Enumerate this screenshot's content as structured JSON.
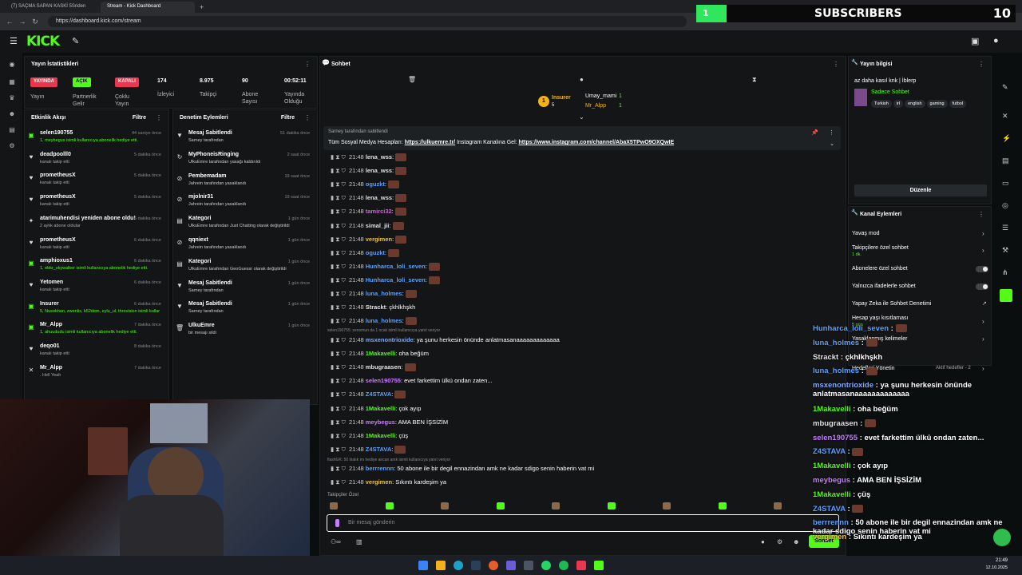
{
  "browser": {
    "tabs": [
      {
        "label": "(7) SAÇMA SAPAN KASKİ 5Sriden"
      },
      {
        "label": "Stream - Kick Dashboard"
      }
    ],
    "url": "https://dashboard.kick.com/stream"
  },
  "subs_overlay": {
    "start": "1",
    "label": "SUBSCRIBERS",
    "count": "10",
    "progress": 0.1
  },
  "header": {
    "logo": "KICK"
  },
  "stats": {
    "title": "Yayın İstatistikleri",
    "badges": [
      {
        "text": "YAYINDA",
        "label": "Yayın",
        "color": "#e8374f"
      },
      {
        "text": "AÇIK",
        "label": "Partnerlik Gelir",
        "color": "#53fc18"
      },
      {
        "text": "KAPALI",
        "label": "Çoklu Yayın",
        "color": "#e8374f"
      }
    ],
    "values": [
      {
        "value": "174",
        "label": "İzleyici"
      },
      {
        "value": "8.975",
        "label": "Takipçi"
      },
      {
        "value": "90",
        "label": "Abone Sayısı"
      },
      {
        "value": "00:52:11",
        "label": "Yayında Olduğu"
      }
    ]
  },
  "activity": {
    "title": "Etkinlik Akışı",
    "filter": "Filtre",
    "items": [
      {
        "name": "selen190755",
        "sub": "1, meybegus isimli kullanıcıya abonelik hediye etti.",
        "time": "44 saniye önce",
        "icon": "gift-icon"
      },
      {
        "name": "deadpoolll0",
        "sub": "kanalı takip etti",
        "time": "5 dakika önce",
        "icon": "heart-icon"
      },
      {
        "name": "prometheusX",
        "sub": "kanalı takip etti",
        "time": "5 dakika önce",
        "icon": "heart-icon"
      },
      {
        "name": "prometheusX",
        "sub": "kanalı takip etti",
        "time": "5 dakika önce",
        "icon": "heart-icon"
      },
      {
        "name": "atarimuhendisi yeniden abone oldu!",
        "sub": "2 aylık abone oldular",
        "time": "6 dakika önce",
        "icon": "star-icon"
      },
      {
        "name": "prometheusX",
        "sub": "kanalı takip etti",
        "time": "6 dakika önce",
        "icon": "heart-icon"
      },
      {
        "name": "amphioxus1",
        "sub": "1, ebkr_skywalker isimli kullanıcıya abonelik hediye etti.",
        "time": "6 dakika önce",
        "icon": "gift-icon"
      },
      {
        "name": "Yetomen",
        "sub": "kanalı takip etti",
        "time": "6 dakika önce",
        "icon": "heart-icon"
      },
      {
        "name": "Insurer",
        "sub": "5, Nusokhan, zwenlis, k52dem, eylu_ul, throvision isimli kullanıcıya abonelik hediye etti.",
        "time": "6 dakika önce",
        "icon": "gift-icon"
      },
      {
        "name": "Mr_Alpp",
        "sub": "1, ahuududu isimli kullanıcıya abonelik hediye etti.",
        "time": "7 dakika önce",
        "icon": "gift-icon"
      },
      {
        "name": "deqo01",
        "sub": "kanalı takip etti",
        "time": "8 dakika önce",
        "icon": "heart-icon"
      },
      {
        "name": "Mr_Alpp",
        "sub": ". Hell Yeah",
        "time": "7 dakika önce",
        "icon": "x-icon"
      }
    ]
  },
  "moderation": {
    "title": "Denetim Eylemleri",
    "filter": "Filtre",
    "items": [
      {
        "name": "Mesaj Sabitlendi",
        "sub": "Sarney tarafından",
        "time": "51 dakika önce",
        "icon": "pin-icon"
      },
      {
        "name": "MyPhoneisRinging",
        "sub": "UlkuEmre tarafından yasağı kaldırıldı",
        "time": "2 saat önce",
        "icon": "unban-icon"
      },
      {
        "name": "Pembemadam",
        "sub": "Jahrein tarafından yasaklandı",
        "time": "19 saat önce",
        "icon": "ban-icon"
      },
      {
        "name": "mjolnir31",
        "sub": "Jahrein tarafından yasaklandı",
        "time": "19 saat önce",
        "icon": "ban-icon"
      },
      {
        "name": "Kategori",
        "sub": "UlkuEmre tarafından Just Chatting olarak değiştirildi",
        "time": "1 gün önce",
        "icon": "category-icon"
      },
      {
        "name": "qqniext",
        "sub": "Jahrein tarafından yasaklandı",
        "time": "1 gün önce",
        "icon": "ban-icon"
      },
      {
        "name": "Kategori",
        "sub": "UlkuEmre tarafından GeoGuessr olarak değiştirildi",
        "time": "1 gün önce",
        "icon": "category-icon"
      },
      {
        "name": "Mesaj Sabitlendi",
        "sub": "Sarney tarafından",
        "time": "1 gün önce",
        "icon": "pin-icon"
      },
      {
        "name": "Mesaj Sabitlendi",
        "sub": "Sarney tarafından",
        "time": "1 gün önce",
        "icon": "pin-icon"
      },
      {
        "name": "UlkuEmre",
        "sub": "bir mesajı sildi",
        "time": "1 gün önce",
        "icon": "trash-icon"
      }
    ]
  },
  "chat": {
    "title": "Sohbet",
    "top_gifters": [
      {
        "name": "Insurer",
        "count": "5"
      },
      {
        "name": "Umay_mami",
        "count": "1"
      },
      {
        "name": "Mr_Alpp",
        "count": "1"
      }
    ],
    "pinned": {
      "by": "Sarney tarafından sabitlendi",
      "text_prefix": "Tüm Sosyal Medya Hesapları:",
      "link1": "https://ulkuemre.tr/",
      "middle": "Instagram Kanalına Gel:",
      "link2": "https://www.instagram.com/channel/AbaX5TPwO9OXQwIE"
    },
    "messages": [
      {
        "time": "21:48",
        "user": "lena_wss",
        "color": "#e0e0e0",
        "text": ""
      },
      {
        "time": "21:48",
        "user": "lena_wss",
        "color": "#e0e0e0",
        "text": ""
      },
      {
        "time": "21:48",
        "user": "oguzkt",
        "color": "#5aa0ff",
        "text": ""
      },
      {
        "time": "21:48",
        "user": "lena_wss",
        "color": "#e0e0e0",
        "text": ""
      },
      {
        "time": "21:48",
        "user": "tamirci32",
        "color": "#d45fd9",
        "text": ""
      },
      {
        "time": "21:48",
        "user": "simal_jii",
        "color": "#e0e0e0",
        "text": ""
      },
      {
        "time": "21:48",
        "user": "vergimen",
        "color": "#e8c24a",
        "text": ""
      },
      {
        "time": "21:48",
        "user": "oguzkt",
        "color": "#5aa0ff",
        "text": ""
      },
      {
        "time": "21:48",
        "user": "Hunharca_loli_seven",
        "color": "#5aa0ff",
        "text": ""
      },
      {
        "time": "21:48",
        "user": "Hunharca_loli_seven",
        "color": "#5aa0ff",
        "text": ""
      },
      {
        "time": "21:48",
        "user": "luna_holmes",
        "color": "#5aa0ff",
        "text": ""
      },
      {
        "time": "21:48",
        "user": "Strackt",
        "color": "#e0e0e0",
        "text": "çkhlkhşkh"
      },
      {
        "time": "21:48",
        "user": "luna_holmes",
        "color": "#5aa0ff",
        "text": ""
      }
    ],
    "reply_note_1": "selen190755: zenomun da 1 ocak isimli kullanıcıya yanıt veriyor",
    "messages2": [
      {
        "time": "21:48",
        "user": "msxenontrioxide",
        "color": "#7fa8ff",
        "text": "ya şunu herkesin önünde anlatmasanaaaaaaaaaaaaa"
      },
      {
        "time": "21:48",
        "user": "1Makavelli",
        "color": "#53fc18",
        "text": "oha beğüm"
      },
      {
        "time": "21:48",
        "user": "mbugraasen",
        "color": "#e0e0e0",
        "text": ""
      },
      {
        "time": "21:48",
        "user": "selen190755",
        "color": "#c77dff",
        "text": "evet farkettim ülkü ondan zaten..."
      },
      {
        "time": "21:48",
        "user": "Z4STAVA",
        "color": "#5aa0ff",
        "text": ""
      },
      {
        "time": "21:48",
        "user": "1Makavelli",
        "color": "#53fc18",
        "text": "çok ayıp"
      },
      {
        "time": "21:48",
        "user": "meybegus",
        "color": "#c77dff",
        "text": "AMA BEN İŞSİZİM"
      },
      {
        "time": "21:48",
        "user": "1Makavelli",
        "color": "#53fc18",
        "text": "çüş"
      },
      {
        "time": "21:48",
        "user": "Z4STAVA",
        "color": "#5aa0ff",
        "text": ""
      }
    ],
    "reply_note_2": "flashGK: 50 liralık mı hediye aircan amk isimli kullanıcıya yanıt veriyor",
    "messages3": [
      {
        "time": "21:48",
        "user": "berrrennn",
        "color": "#5aa0ff",
        "text": "50 abone ile bir degil ennazindan amk ne kadar sdigo senin haberin vat mi"
      },
      {
        "time": "21:48",
        "user": "vergimen",
        "color": "#e8c24a",
        "text": "Sıkıntı kardeşim ya"
      }
    ],
    "followers_only": "Takipçiler Özel",
    "input_placeholder": "Bir mesaj gönderin",
    "send_label": "Sohbet"
  },
  "overlay_chat": [
    {
      "user": "Hunharca_loli_seven",
      "color": "#5aa0ff",
      "text": ""
    },
    {
      "user": "luna_holmes",
      "color": "#5aa0ff",
      "text": ""
    },
    {
      "user": "Strackt",
      "color": "#e0e0e0",
      "text": "çkhlkhşkh"
    },
    {
      "user": "luna_holmes",
      "color": "#5aa0ff",
      "text": ""
    },
    {
      "user": "msxenontrioxide",
      "color": "#7fa8ff",
      "text": "ya şunu herkesin önünde anlatmasanaaaaaaaaaaaaa"
    },
    {
      "user": "1Makavelli",
      "color": "#53fc18",
      "text": "oha beğüm"
    },
    {
      "user": "mbugraasen",
      "color": "#e0e0e0",
      "text": ""
    },
    {
      "user": "selen190755",
      "color": "#c77dff",
      "text": "evet farkettim ülkü ondan zaten..."
    },
    {
      "user": "Z4STAVA",
      "color": "#5aa0ff",
      "text": ""
    },
    {
      "user": "1Makavelli",
      "color": "#53fc18",
      "text": "çok ayıp"
    },
    {
      "user": "meybegus",
      "color": "#c77dff",
      "text": "AMA BEN İŞSİZİM"
    },
    {
      "user": "1Makavelli",
      "color": "#53fc18",
      "text": "çüş"
    },
    {
      "user": "Z4STAVA",
      "color": "#5aa0ff",
      "text": ""
    },
    {
      "user": "berrrennn",
      "color": "#5aa0ff",
      "text": "50 abone ile bir degil ennazindan amk ne kadar sdigo senin haberin vat mi"
    },
    {
      "user": "vergimen",
      "color": "#e8c24a",
      "text": "Sıkıntı kardeşim ya"
    }
  ],
  "stream_info": {
    "title": "Yayın bilgisi",
    "stream_title": "az daha kasıl knk | İblerp",
    "category": "Sadece Sohbet",
    "tags": [
      "Turkish",
      "irl",
      "english",
      "gaming",
      "futbol"
    ],
    "edit_label": "Düzenle"
  },
  "channel_actions": {
    "title": "Kanal Eylemleri",
    "slow_mode": "Yavaş mod",
    "followers_only": "Takipçilere özel sohbet",
    "followers_only_sub": "1 dk.",
    "subs_only": "Abonelere özel sohbet",
    "emotes_only": "Yalnızca ifadelerle sohbet",
    "ai_mod": "Yapay Zeka ile Sohbet Denetimi",
    "account_age": "Hesap yaşı kısıtlaması",
    "account_age_sub": "5 gün",
    "banned_words": "Yasaklanmış kelimeler",
    "goals": "Hedefleri Yönetin",
    "goals_sub": "Aktif hedefler - 2"
  },
  "taskbar": {
    "time": "21:49",
    "date": "12.10.2025"
  }
}
